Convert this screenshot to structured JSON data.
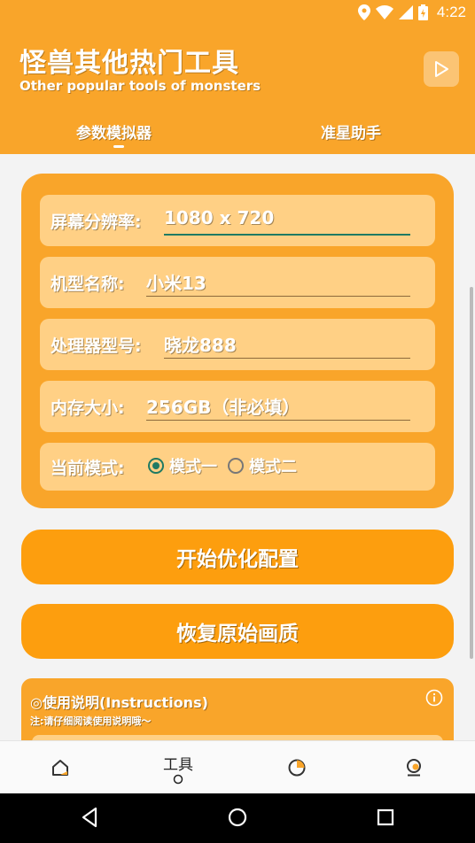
{
  "status_bar": {
    "time": "4:22"
  },
  "header": {
    "title": "怪兽其他热门工具",
    "subtitle": "Other popular tools of monsters",
    "tabs": [
      {
        "label": "参数模拟器",
        "selected": true
      },
      {
        "label": "准星助手",
        "selected": false
      }
    ]
  },
  "form": {
    "resolution": {
      "label": "屏幕分辨率:",
      "value": "1080 x 720"
    },
    "model": {
      "label": "机型名称:",
      "value": "小米13"
    },
    "processor": {
      "label": "处理器型号:",
      "value": "晓龙888"
    },
    "memory": {
      "label": "内存大小:",
      "value": "256GB（非必填）"
    },
    "mode": {
      "label": "当前模式:",
      "options": [
        {
          "label": "模式一",
          "checked": true
        },
        {
          "label": "模式二",
          "checked": false
        }
      ]
    }
  },
  "buttons": {
    "start": "开始优化配置",
    "restore": "恢复原始画质"
  },
  "instructions": {
    "title": "◎使用说明(Instructions)",
    "note": "注:请仔细阅读使用说明哦～"
  },
  "bottom_nav": {
    "items": [
      {
        "icon": "home-icon",
        "label": ""
      },
      {
        "icon": "circle-indicator-icon",
        "label": "工具"
      },
      {
        "icon": "pie-chart-icon",
        "label": ""
      },
      {
        "icon": "profile-icon",
        "label": ""
      }
    ]
  },
  "colors": {
    "primary": "#f9a52a",
    "row_bg": "#ffd085",
    "button": "#fd9e0e",
    "accent": "#1f7a63"
  }
}
